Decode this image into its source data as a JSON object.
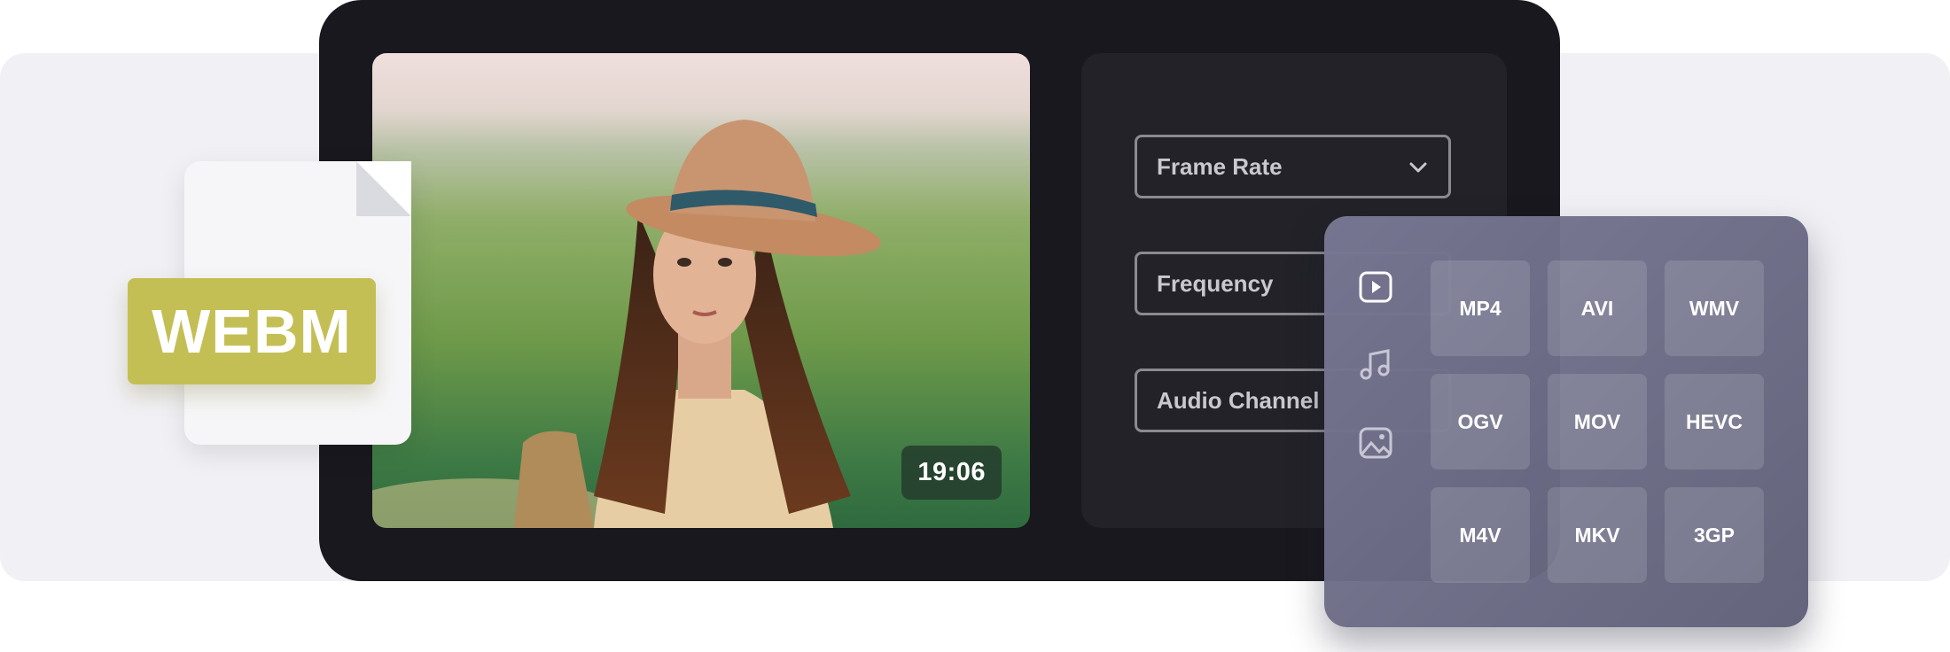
{
  "preview": {
    "duration": "19:06"
  },
  "settings": {
    "fields": [
      {
        "label": "Frame Rate",
        "has_dropdown": true
      },
      {
        "label": "Frequency",
        "has_dropdown": false
      },
      {
        "label": "Audio Channel",
        "has_dropdown": false
      }
    ]
  },
  "source_file": {
    "format": "WEBM",
    "badge_color": "#c4bf55"
  },
  "format_picker": {
    "categories": [
      {
        "icon": "video-icon",
        "active": true
      },
      {
        "icon": "music-icon",
        "active": false
      },
      {
        "icon": "image-icon",
        "active": false
      }
    ],
    "formats": [
      "MP4",
      "AVI",
      "WMV",
      "OGV",
      "MOV",
      "HEVC",
      "M4V",
      "MKV",
      "3GP"
    ]
  }
}
